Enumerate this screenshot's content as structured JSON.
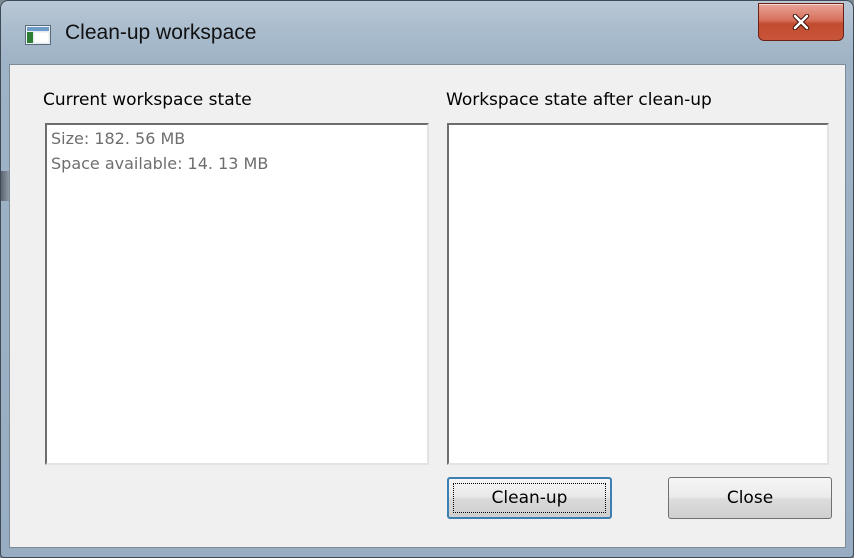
{
  "window": {
    "title": "Clean-up workspace",
    "icon": "application-window-icon",
    "close_icon": "close-icon"
  },
  "current_panel": {
    "label": "Current workspace state",
    "lines": [
      "Size: 182. 56 MB",
      "Space available: 14. 13 MB"
    ]
  },
  "after_panel": {
    "label": "Workspace state after clean-up",
    "lines": []
  },
  "buttons": {
    "cleanup_label": "Clean-up",
    "close_label": "Close"
  },
  "colors": {
    "close_button": "#c8553a",
    "dialog_background": "#f0f0f0",
    "info_text": "#6e6e6e"
  }
}
